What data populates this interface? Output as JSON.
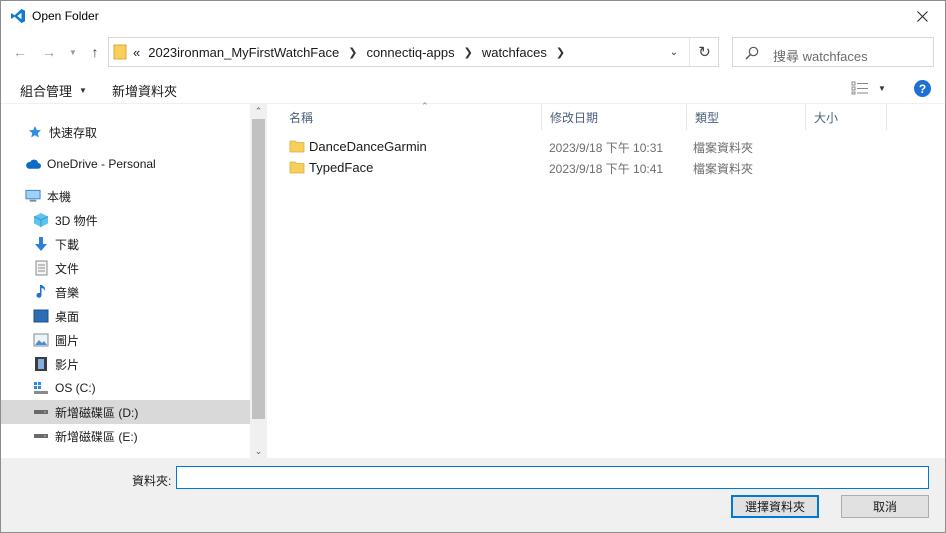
{
  "window": {
    "title": "Open Folder"
  },
  "address": {
    "overflow": "«",
    "crumbs": [
      "2023ironman_MyFirstWatchFace",
      "connectiq-apps",
      "watchfaces"
    ]
  },
  "search": {
    "placeholder": "搜尋 watchfaces"
  },
  "toolbar": {
    "organize": "組合管理",
    "new_folder": "新增資料夾"
  },
  "nav": {
    "items": [
      {
        "label": "快速存取",
        "icon": "star-icon"
      },
      {
        "label": "OneDrive - Personal",
        "icon": "cloud-icon"
      },
      {
        "label": "本機",
        "icon": "computer-icon"
      },
      {
        "label": "3D 物件",
        "icon": "cube-icon"
      },
      {
        "label": "下載",
        "icon": "download-icon"
      },
      {
        "label": "文件",
        "icon": "document-icon"
      },
      {
        "label": "音樂",
        "icon": "music-icon"
      },
      {
        "label": "桌面",
        "icon": "desktop-icon"
      },
      {
        "label": "圖片",
        "icon": "picture-icon"
      },
      {
        "label": "影片",
        "icon": "video-icon"
      },
      {
        "label": "OS (C:)",
        "icon": "os-drive-icon"
      },
      {
        "label": "新增磁碟區 (D:)",
        "icon": "drive-icon"
      },
      {
        "label": "新增磁碟區 (E:)",
        "icon": "drive-icon"
      }
    ]
  },
  "columns": {
    "name": "名稱",
    "date": "修改日期",
    "type": "類型",
    "size": "大小"
  },
  "files": [
    {
      "name": "DanceDanceGarmin",
      "date": "2023/9/18 下午 10:31",
      "type": "檔案資料夾"
    },
    {
      "name": "TypedFace",
      "date": "2023/9/18 下午 10:41",
      "type": "檔案資料夾"
    }
  ],
  "footer": {
    "folder_label": "資料夾:",
    "folder_value": "",
    "select_button": "選擇資料夾",
    "cancel_button": "取消"
  },
  "colors": {
    "accent": "#0078d7",
    "folder": "#f7cf5a",
    "selection": "#d9d9d9",
    "vscode_blue": "#0e7ad3"
  }
}
